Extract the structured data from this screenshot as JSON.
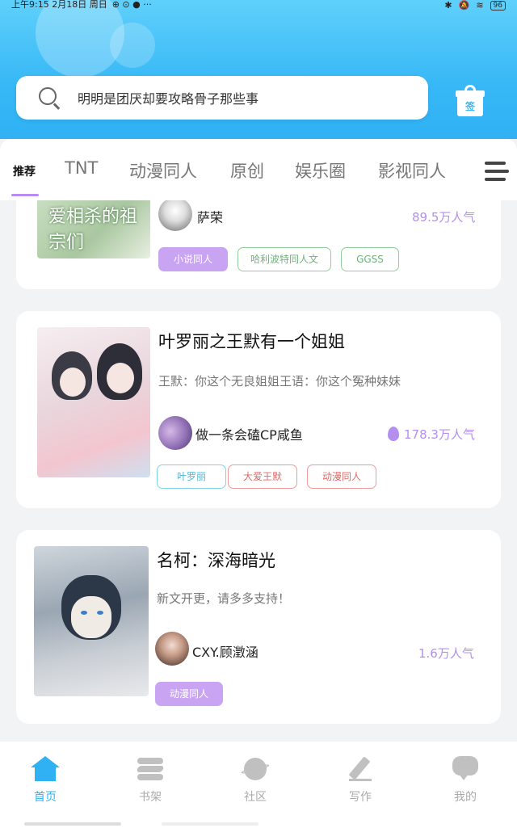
{
  "status": {
    "time": "上午9:15 2月18日 周日",
    "battery": "96"
  },
  "search": {
    "placeholder": "明明是团厌却要攻略骨子那些事"
  },
  "gift": {
    "label": "签"
  },
  "tabs": [
    {
      "label": "推荐",
      "active": true
    },
    {
      "label": "TNT"
    },
    {
      "label": "动漫同人"
    },
    {
      "label": "原创"
    },
    {
      "label": "娱乐圈"
    },
    {
      "label": "影视同人"
    }
  ],
  "cards": [
    {
      "cover_text": "爱相杀的祖宗们",
      "author": "萨荣",
      "popularity": "89.5万人气",
      "tags": [
        "小说同人",
        "哈利波特同人文",
        "GGSS"
      ]
    },
    {
      "title": "叶罗丽之王默有一个姐姐",
      "desc": "王默：你这个无良姐姐王语：你这个冤种妹妹",
      "author": "做一条会磕CP咸鱼",
      "popularity": "178.3万人气",
      "tags": [
        "叶罗丽",
        "大爱王默",
        "动漫同人"
      ]
    },
    {
      "title": "名柯：深海暗光",
      "desc": "新文开更，请多多支持！",
      "author": "CXY.顾澂涵",
      "popularity": "1.6万人气",
      "tags": [
        "动漫同人"
      ]
    }
  ],
  "nav": [
    {
      "label": "首页",
      "icon": "home-icon",
      "active": true
    },
    {
      "label": "书架",
      "icon": "bookshelf-icon"
    },
    {
      "label": "社区",
      "icon": "planet-icon"
    },
    {
      "label": "写作",
      "icon": "pen-icon"
    },
    {
      "label": "我的",
      "icon": "chat-bubble-icon"
    }
  ],
  "colors": {
    "accent": "#2fb1f4",
    "purple": "#b48ff0"
  }
}
